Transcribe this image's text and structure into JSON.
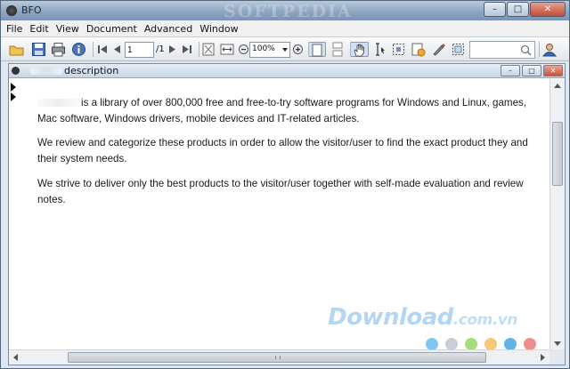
{
  "window": {
    "title": "BFO",
    "watermark": "SOFTPEDIA",
    "buttons": {
      "minimize": "–",
      "maximize": "□",
      "close": "✕"
    }
  },
  "menu": [
    "File",
    "Edit",
    "View",
    "Document",
    "Advanced",
    "Window"
  ],
  "toolbar": {
    "page_current": "1",
    "page_total": "/1",
    "zoom": "100%",
    "icons": [
      "open-folder-icon",
      "save-icon",
      "print-icon",
      "info-icon",
      "first-page-icon",
      "prev-page-icon",
      "next-page-icon",
      "last-page-icon",
      "fit-page-icon",
      "fit-width-icon",
      "zoom-out-icon",
      "zoom-in-icon",
      "single-page-icon",
      "continuous-page-icon",
      "hand-tool-icon",
      "text-select-icon",
      "select-area-icon",
      "annotate-icon",
      "sign-icon",
      "snapshot-icon",
      "search-icon",
      "user-icon"
    ]
  },
  "document": {
    "tab_label": "description",
    "paragraphs": [
      "is a library of over 800,000 free and free-to-try software programs for Windows and Linux, games, Mac software, Windows drivers, mobile devices and IT-related articles.",
      "We review and categorize these products in order to allow the visitor/user to find the exact product they and their system needs.",
      "We strive to deliver only the best products to the visitor/user together with self-made evaluation and review notes."
    ],
    "brand_watermark": "Download",
    "brand_suffix": ".com.vn",
    "dot_colors": [
      "#7fc8ef",
      "#c9cfd6",
      "#a6dd7e",
      "#f6c87a",
      "#63b1e9",
      "#f08f8f"
    ]
  }
}
